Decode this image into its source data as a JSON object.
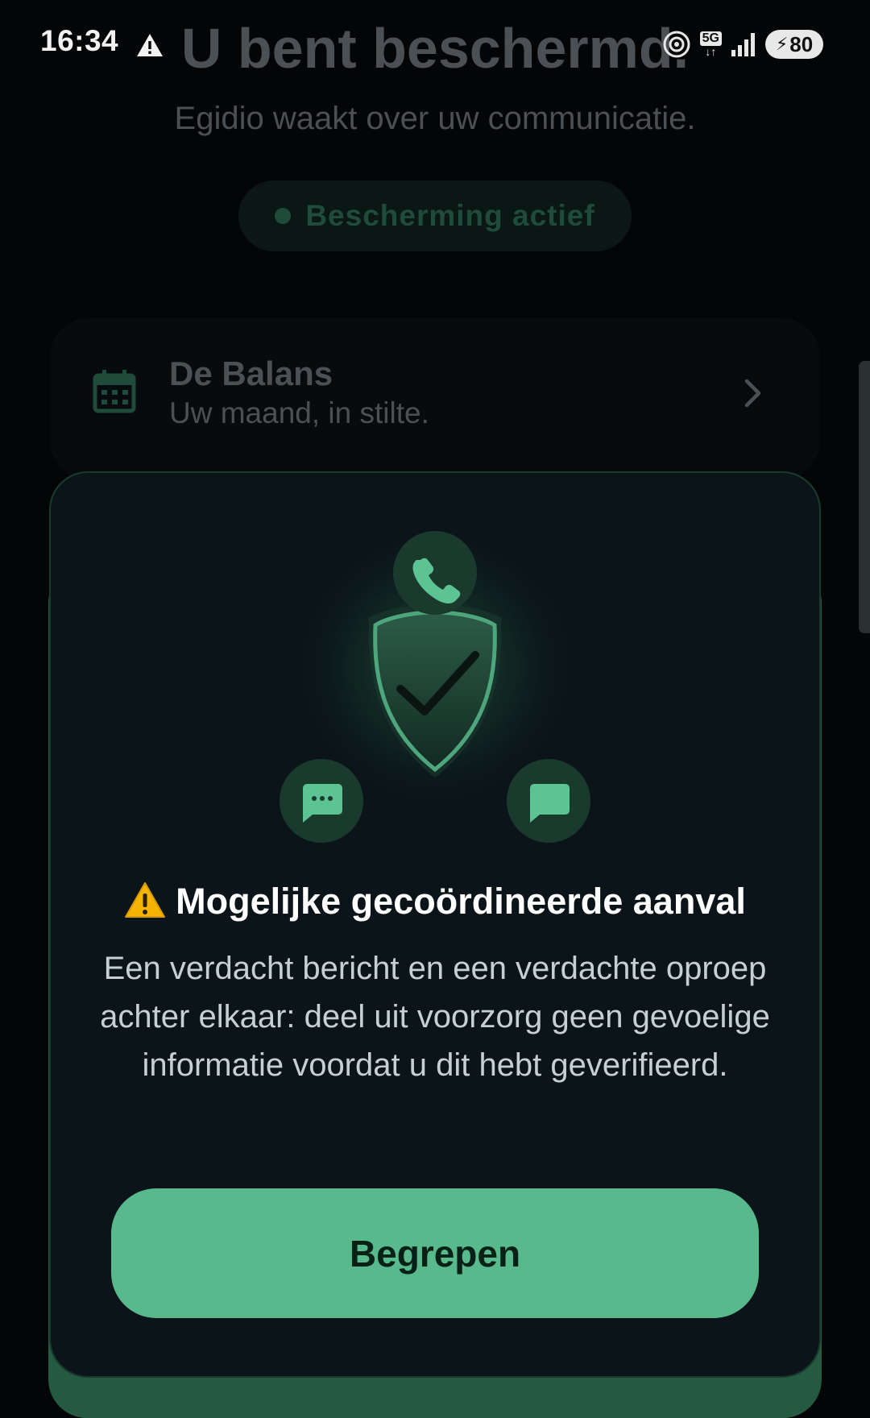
{
  "status_bar": {
    "time": "16:34",
    "network": "5G",
    "battery": "80",
    "icons": [
      "warning-icon",
      "hotspot-icon",
      "5g-icon",
      "signal-icon",
      "battery-charging-icon"
    ]
  },
  "background_page": {
    "title": "U bent beschermd.",
    "subtitle": "Egidio waakt over uw communicatie.",
    "status_pill": "Bescherming actief",
    "balance_card": {
      "title": "De Balans",
      "subtitle": "Uw maand, in stilte.",
      "icon": "calendar-icon"
    }
  },
  "alert": {
    "title": "Mogelijke gecoördineerde aanval",
    "body": "Een verdacht bericht en een verdachte oproep achter elkaar: deel uit voorzorg geen gevoelige informatie voordat u dit hebt geverifieerd.",
    "button_label": "Begrepen",
    "illustration_icons": [
      "shield-check-icon",
      "phone-icon",
      "sms-icon",
      "chat-icon"
    ]
  },
  "colors": {
    "accent": "#58ba8c",
    "background": "#030506",
    "sheet": "#0b1519",
    "warning": "#f5b400"
  }
}
